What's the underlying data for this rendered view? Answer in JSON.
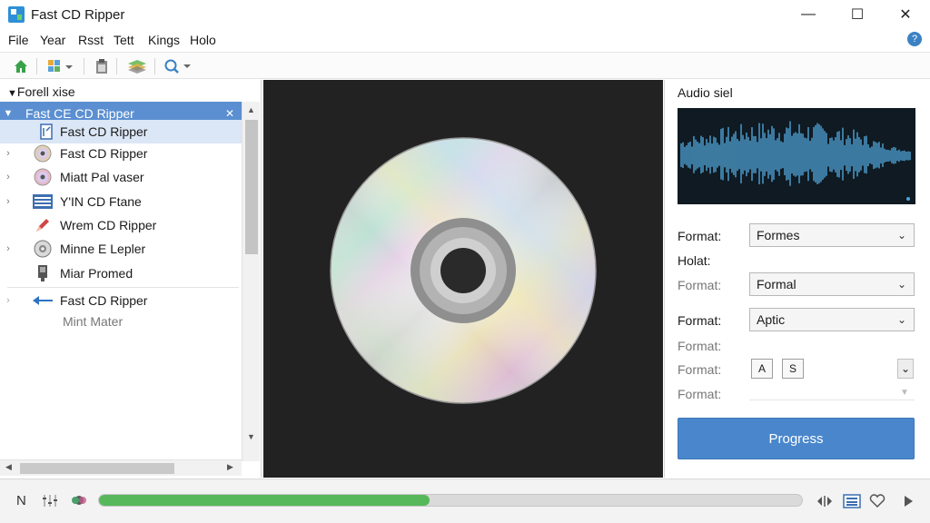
{
  "window": {
    "title": "Fast CD Ripper",
    "minimize": "—",
    "maximize": "☐",
    "close": "✕"
  },
  "menu": [
    "File",
    "Year",
    "Rsst",
    "Tett",
    "Kings",
    "Holo"
  ],
  "tree": {
    "header": "Forell xise",
    "items": [
      {
        "label": "Fast CE CD Ripper",
        "icon": "chevron-down-icon",
        "state": "selected"
      },
      {
        "label": "Fast CD Ripper",
        "icon": "document-icon",
        "state": "highlight"
      },
      {
        "label": "Fast CD Ripper",
        "icon": "disc-icon",
        "state": "normal"
      },
      {
        "label": "Miatt Pal vaser",
        "icon": "disc-icon",
        "state": "normal"
      },
      {
        "label": "Y'IN CD Ftane",
        "icon": "list-icon",
        "state": "normal"
      },
      {
        "label": "Wrem CD Ripper",
        "icon": "pen-icon",
        "state": "normal"
      },
      {
        "label": "Minne E Lepler",
        "icon": "disc-gray-icon",
        "state": "normal"
      },
      {
        "label": "Miar Promed",
        "icon": "device-icon",
        "state": "normal"
      },
      {
        "label": "Fast CD Ripper",
        "icon": "back-arrow-icon",
        "state": "normal"
      },
      {
        "label": "Mint Mater",
        "icon": "",
        "state": "sub"
      }
    ]
  },
  "right": {
    "audio_label": "Audio siel",
    "format_row1": {
      "label": "Format:",
      "value": "Formes"
    },
    "holat_label": "Holat:",
    "format_row2": {
      "label": "Format:",
      "value": "Formal"
    },
    "format_row3": {
      "label": "Format:",
      "value": "Aptic"
    },
    "format_row4": {
      "label": "Format:"
    },
    "format_row5": {
      "label": "Format:",
      "btn_a": "A",
      "btn_b": "S"
    },
    "format_row6": {
      "label": "Format:"
    },
    "progress_button": "Progress"
  },
  "status": {
    "progress": 0.47,
    "left_label": "N"
  },
  "colors": {
    "accent": "#4a86cc",
    "progress": "#56b85a",
    "waveform": "#4fa3d6"
  }
}
